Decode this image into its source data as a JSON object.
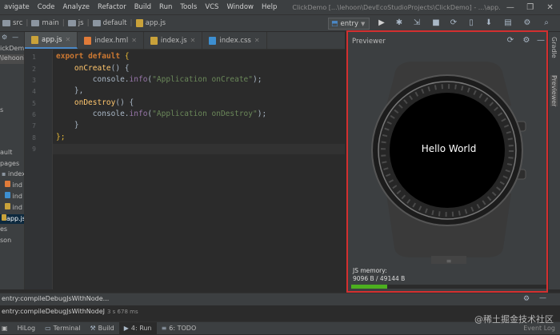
{
  "menu": {
    "items": [
      "avigate",
      "Code",
      "Analyze",
      "Refactor",
      "Build",
      "Run",
      "Tools",
      "VCS",
      "Window",
      "Help"
    ],
    "window_title": "ClickDemo [...\\lehoon\\DevEcoStudioProjects\\ClickDemo] - ...\\app.js [entry]"
  },
  "breadcrumb": {
    "items": [
      "src",
      "main",
      "js",
      "default",
      "app.js"
    ],
    "run_config": "entry"
  },
  "project": {
    "rows": [
      "ickDemo",
      "\\lehoon\\D",
      "s",
      "ault",
      "pages",
      "index",
      "ind",
      "ind",
      "ind",
      "app.js",
      "es",
      "son"
    ]
  },
  "tabs": [
    {
      "label": "app.js",
      "active": true
    },
    {
      "label": "index.hml",
      "active": false
    },
    {
      "label": "index.js",
      "active": false
    },
    {
      "label": "index.css",
      "active": false
    }
  ],
  "editor": {
    "line_numbers": [
      "1",
      "2",
      "3",
      "4",
      "5",
      "6",
      "7",
      "8",
      "9"
    ],
    "code": {
      "l1_kw1": "export",
      "l1_kw2": "default",
      "l1_brace": "{",
      "l2_fn": "onCreate",
      "l2_rest": "() {",
      "l3_obj": "console.",
      "l3_mem": "info",
      "l3_str": "\"Application onCreate\"",
      "l3_end": ");",
      "l4": "},",
      "l5_fn": "onDestroy",
      "l5_rest": "() {",
      "l6_obj": "console.",
      "l6_mem": "info",
      "l6_str": "\"Application onDestroy\"",
      "l6_end": ");",
      "l7": "}",
      "l8": "};"
    }
  },
  "previewer": {
    "title": "Previewer",
    "screen_text": "Hello World",
    "js_memory_label": "JS memory:",
    "js_memory_value": "9096 B / 49144 B",
    "memory_used_fraction": 0.185
  },
  "right_tools": [
    "Gradle",
    "Previewer"
  ],
  "run": {
    "task": "entry:compileDebugJsWithNode...",
    "duration": "3 s 678 ms"
  },
  "status_tabs": [
    "HiLog",
    "Terminal",
    "Build",
    "4: Run",
    "6: TODO"
  ],
  "event_log": "Event Log",
  "watermark": "@稀土掘金技术社区",
  "colors": {
    "accent": "#4a88c7",
    "highlight_border": "#d32f2f",
    "memory_bar": "#4caf1f"
  }
}
